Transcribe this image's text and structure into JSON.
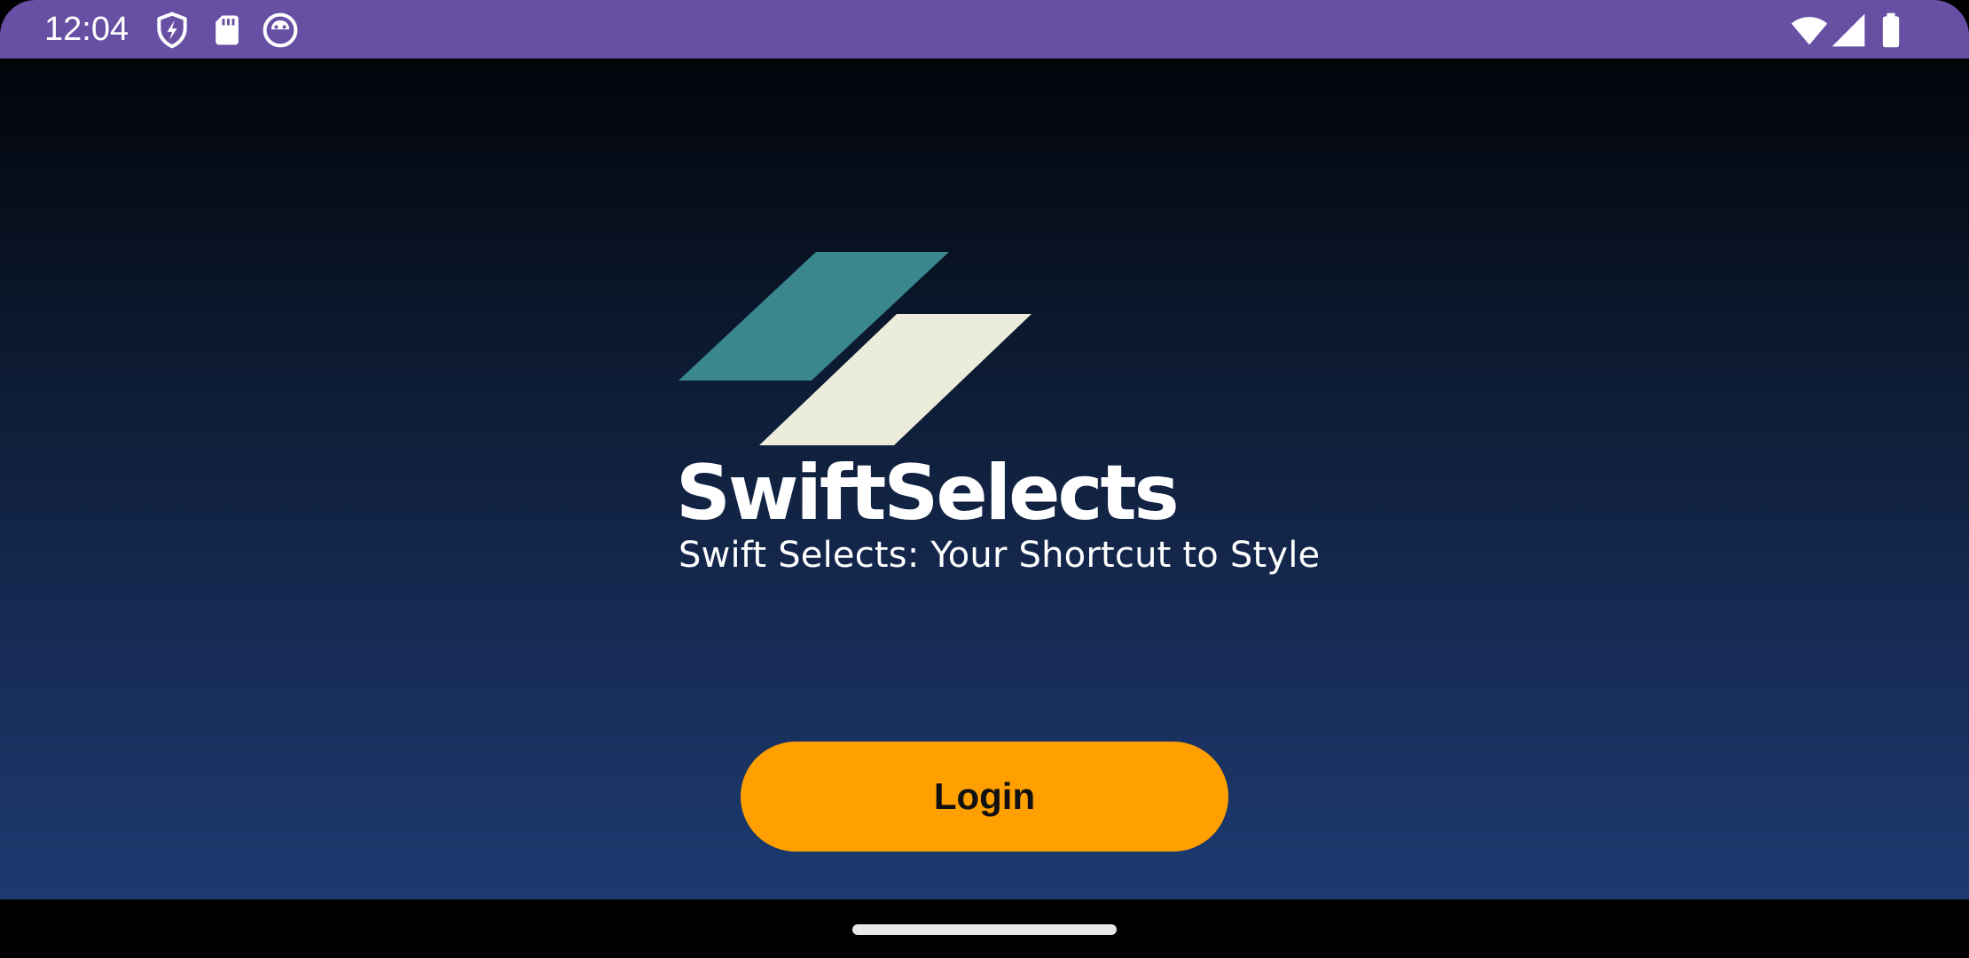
{
  "status_bar": {
    "time": "12:04",
    "left_icons": [
      "shield-icon",
      "sd-card-icon",
      "app-notification-icon"
    ],
    "right_icons": [
      "wifi-icon",
      "cellular-signal-icon",
      "battery-icon"
    ],
    "background_color": "#6750a4"
  },
  "app": {
    "logo": {
      "name": "swiftselects-logo",
      "colors": [
        "#3a8790",
        "#ececda"
      ]
    },
    "title": "SwiftSelects",
    "tagline": "Swift Selects: Your Shortcut to Style",
    "login_button": {
      "label": "Login",
      "color": "#ff9f00"
    },
    "background_gradient": [
      "#020409",
      "#1c3a70"
    ]
  },
  "nav_bar": {
    "handle": "home-gesture-handle"
  }
}
